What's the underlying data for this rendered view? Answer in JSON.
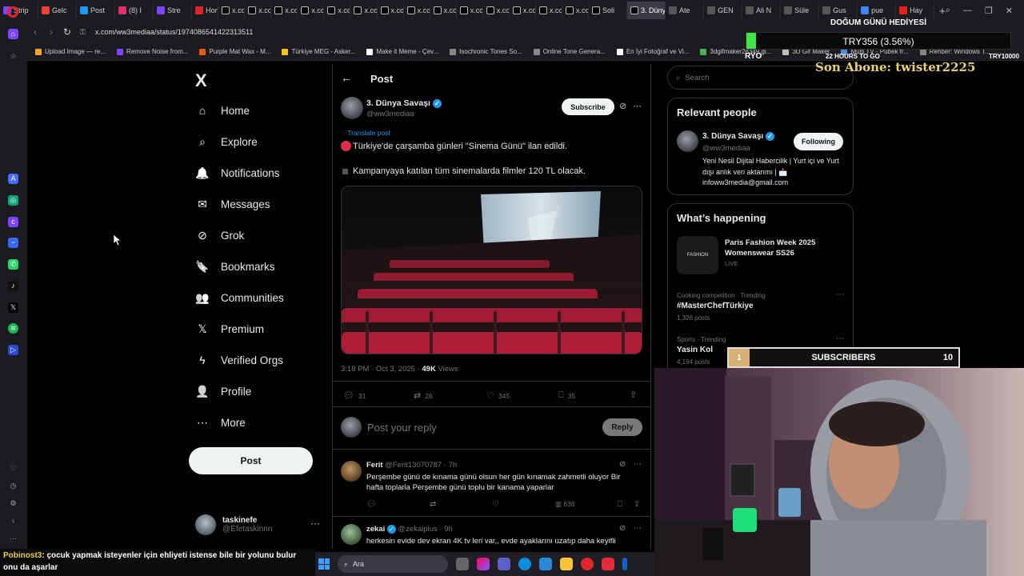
{
  "browser": {
    "tabs": [
      "Strip",
      "Gelc",
      "Post",
      "(8) I",
      "Stre",
      "Hon",
      "x.co",
      "x.co",
      "x.co",
      "x.co",
      "x.co",
      "x.co",
      "x.co",
      "x.co",
      "x.co",
      "x.co",
      "x.co",
      "x.co",
      "x.co",
      "x.co",
      "Soli",
      "3. Düny",
      "Ate",
      "GEN",
      "Ali N",
      "Süle",
      "Gus",
      "pue",
      "Hay"
    ],
    "active_tab_index": 21,
    "new_tab": "+",
    "url": "x.com/ww3mediaa/status/1974086541422313511",
    "bookmarks": [
      "Upload Image — re...",
      "Remove Noise from...",
      "Purple Mat Wax - M...",
      "Türkiye MEG - Asker...",
      "Make it Meme - Çev...",
      "Isochronic Tones So...",
      "Online Tone Genera...",
      "En İyi Fotoğraf ve Vi...",
      "3dgifmaker28349.gi...",
      "3D Gif Maker",
      "Multi TV - Pubek fr...",
      "Rehber: Windows T..."
    ]
  },
  "nav": {
    "logo": "X",
    "items": [
      {
        "label": "Home",
        "icon": "home-icon",
        "glyph": "⌂"
      },
      {
        "label": "Explore",
        "icon": "search-icon",
        "glyph": "⌕"
      },
      {
        "label": "Notifications",
        "icon": "bell-icon",
        "glyph": "🔔"
      },
      {
        "label": "Messages",
        "icon": "envelope-icon",
        "glyph": "✉"
      },
      {
        "label": "Grok",
        "icon": "grok-icon",
        "glyph": "⊘"
      },
      {
        "label": "Bookmarks",
        "icon": "bookmark-icon",
        "glyph": "🔖"
      },
      {
        "label": "Communities",
        "icon": "people-icon",
        "glyph": "👥"
      },
      {
        "label": "Premium",
        "icon": "x-premium-icon",
        "glyph": "𝕏"
      },
      {
        "label": "Verified Orgs",
        "icon": "lightning-icon",
        "glyph": "ϟ"
      },
      {
        "label": "Profile",
        "icon": "person-icon",
        "glyph": "👤"
      },
      {
        "label": "More",
        "icon": "more-circle-icon",
        "glyph": "⋯"
      }
    ],
    "post_button": "Post",
    "account": {
      "name": "taskinefe",
      "handle": "@Efetaskinnn",
      "menu": "···"
    }
  },
  "post": {
    "header_title": "Post",
    "author_name": "3. Dünya Savaşı",
    "author_handle": "@ww3mediaa",
    "subscribe": "Subscribe",
    "translate": "Translate post",
    "line1": "Türkiye'de çarşamba günleri \"Sinema Günü\" ilan edildi.",
    "line2": "Kampanyaya katılan tüm sinemalarda filmler 120 TL olacak.",
    "timestamp": "3:18 PM · Oct 3, 2025 ·",
    "views_count": "49K",
    "views_label": "Views",
    "replies": "31",
    "reposts": "26",
    "likes": "345",
    "bookmarks": "35",
    "reply_placeholder": "Post your reply",
    "reply_button": "Reply"
  },
  "replies": [
    {
      "name": "Ferit",
      "handle": "@Ferit13070787 · 7h",
      "text": "Perşembe günü de kınama günü olsun her gün kınamak zahmetli oluyor Bir hafta toplarla Perşembe günü toplu bir kanama yaparlar",
      "views": "636"
    },
    {
      "name": "zekai",
      "handle": "@zekaiplus · 9h",
      "text": "herkesin evide dev ekran 4K tv leri var,, evde ayaklarını uzatıp daha keyifli"
    }
  ],
  "right": {
    "search_placeholder": "Search",
    "relevant_title": "Relevant people",
    "person": {
      "name": "3. Dünya Savaşı",
      "handle": "@ww3mediaa",
      "button": "Following",
      "bio": "Yeni Nesil Dijital Habercilik | Yurt içi ve Yurt dışı anlık veri aktarımı | 📩 infoww3media@gmail.com"
    },
    "happening_title": "What’s happening",
    "event": {
      "thumb": "FASHION",
      "title": "Paris Fashion Week 2025 Womenswear SS26",
      "status": "LIVE"
    },
    "trends": [
      {
        "context": "Cooking competition · Trending",
        "name": "#MasterChefTürkiye",
        "count": "1,326 posts"
      },
      {
        "context": "Sports · Trending",
        "name": "Yasin Kol",
        "count": "4,194 posts"
      }
    ]
  },
  "overlay": {
    "gift_title": "DOĞUM GÜNÜ HEDİYESİ",
    "goal": "TRY356 (3.56%)",
    "goal_progress": 3.56,
    "left": "RYO",
    "mid": "22 HOURS TO GO",
    "right": "TRY10000",
    "sub_text": "Son Abone: twister2225",
    "subs_index": "1",
    "subs_label": "SUBSCRIBERS",
    "subs_goal": "10"
  },
  "chat": {
    "user": "Pobinost3",
    "message": ": çocuk yapmak isteyenler için ehliyeti istense bile bir yolunu bulur onu da aşarlar"
  },
  "taskbar": {
    "search": "Ara"
  },
  "colors": {
    "accent": "#1d9bf0",
    "background": "#000000",
    "muted": "#71767b",
    "goal_bar": "#3fe44b",
    "sub_text": "#e7d46a"
  }
}
